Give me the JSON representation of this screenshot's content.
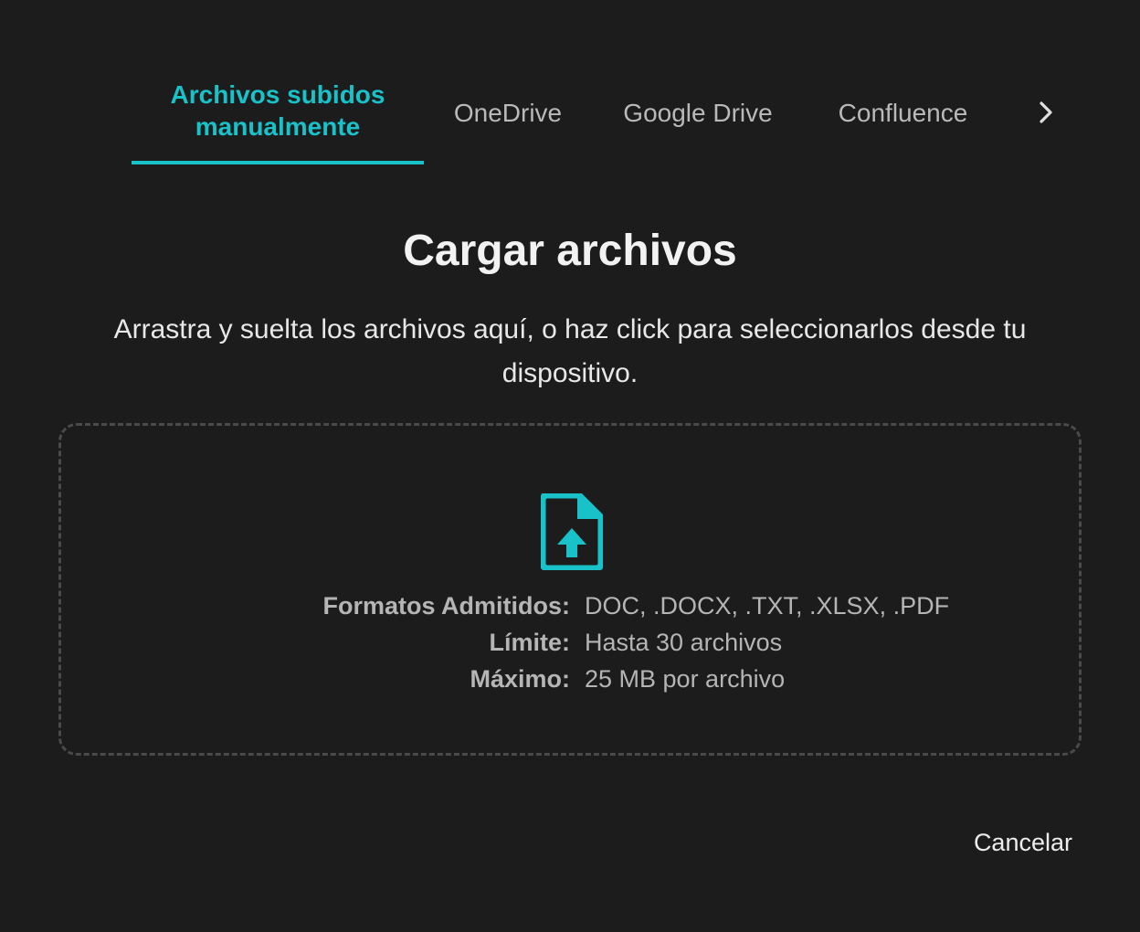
{
  "tabs": {
    "items": [
      {
        "label": "Archivos subidos manualmente",
        "active": true
      },
      {
        "label": "OneDrive",
        "active": false
      },
      {
        "label": "Google Drive",
        "active": false
      },
      {
        "label": "Confluence",
        "active": false
      }
    ],
    "next_icon": "chevron-right-icon"
  },
  "main": {
    "title": "Cargar archivos",
    "description": "Arrastra y suelta los archivos aquí, o haz click para seleccionarlos desde tu dispositivo."
  },
  "dropzone": {
    "icon": "file-upload-icon",
    "specs": [
      {
        "label": "Formatos Admitidos:",
        "value": "DOC, .DOCX, .TXT, .XLSX, .PDF"
      },
      {
        "label": "Límite:",
        "value": "Hasta 30 archivos"
      },
      {
        "label": "Máximo:",
        "value": "25 MB por archivo"
      }
    ]
  },
  "footer": {
    "cancel_label": "Cancelar"
  },
  "colors": {
    "accent": "#19c1c9",
    "background": "#1c1c1c",
    "muted_text": "#b5b5b5"
  }
}
